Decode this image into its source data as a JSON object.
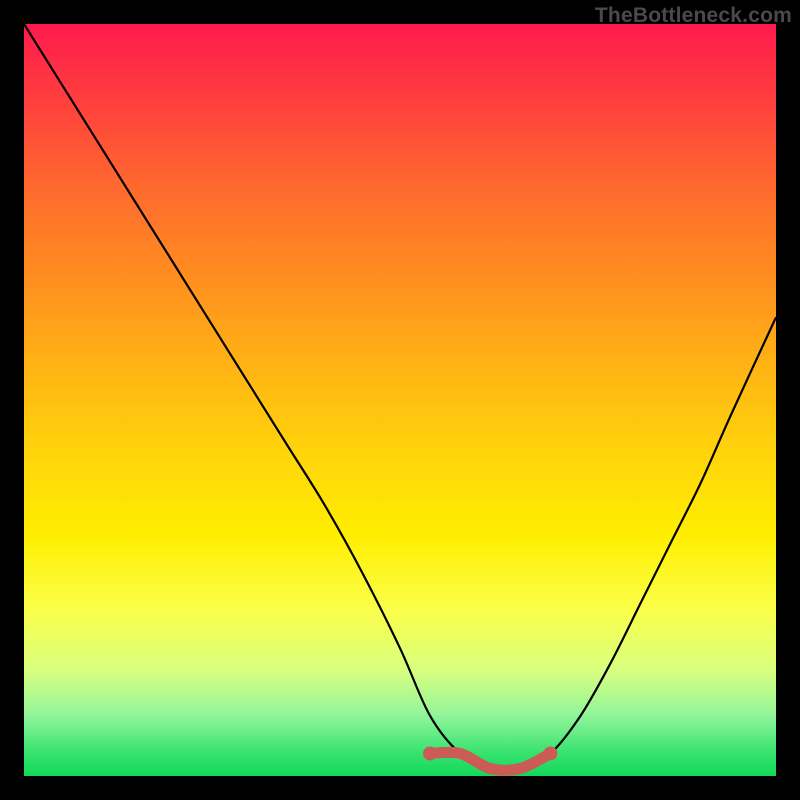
{
  "watermark_text": "TheBottleneck.com",
  "chart_data": {
    "type": "line",
    "title": "",
    "xlabel": "",
    "ylabel": "",
    "xlim": [
      0,
      100
    ],
    "ylim": [
      0,
      100
    ],
    "series": [
      {
        "name": "bottleneck-curve",
        "x": [
          0,
          5,
          10,
          15,
          20,
          25,
          30,
          35,
          40,
          45,
          50,
          54,
          58,
          62,
          66,
          70,
          74,
          78,
          82,
          86,
          90,
          94,
          100
        ],
        "values": [
          100,
          92,
          84,
          76,
          68,
          60,
          52,
          44,
          36,
          27,
          17,
          8,
          3,
          1,
          1,
          3,
          8,
          15,
          23,
          31,
          39,
          48,
          61
        ]
      }
    ],
    "highlight_range": {
      "series": "bottleneck-curve",
      "x_start": 54,
      "x_end": 70,
      "value_max": 3
    },
    "background": {
      "type": "vertical-gradient",
      "stops": [
        {
          "pos": 0,
          "color": "#ff1a4d"
        },
        {
          "pos": 22,
          "color": "#ff6a2e"
        },
        {
          "pos": 46,
          "color": "#ffb514"
        },
        {
          "pos": 68,
          "color": "#ffee00"
        },
        {
          "pos": 86,
          "color": "#d8ff80"
        },
        {
          "pos": 100,
          "color": "#13d85a"
        }
      ]
    }
  }
}
